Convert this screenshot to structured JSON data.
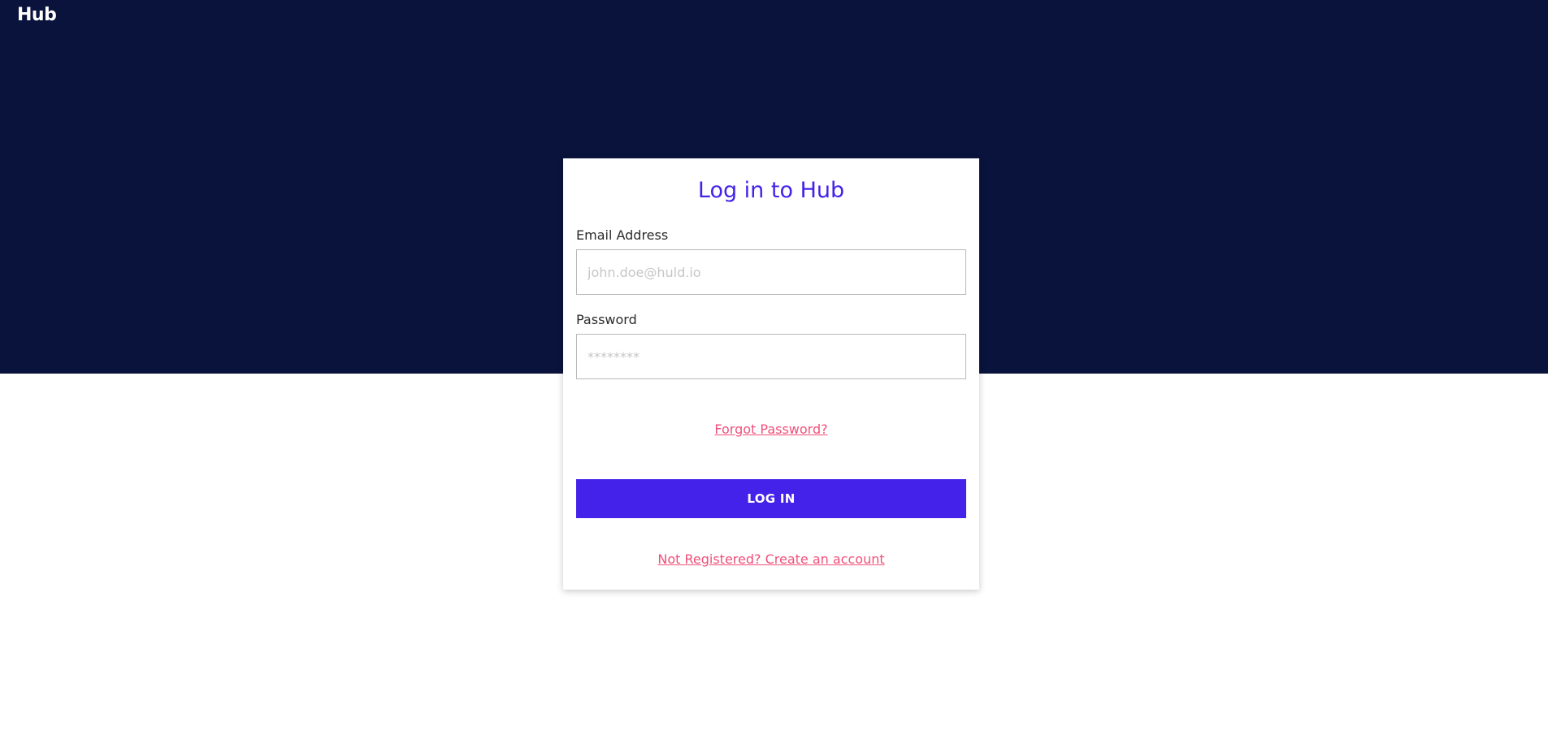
{
  "header": {
    "brand": "Hub"
  },
  "login_card": {
    "title": "Log in to Hub",
    "email": {
      "label": "Email Address",
      "value": "",
      "placeholder": "john.doe@huld.io"
    },
    "password": {
      "label": "Password",
      "value": "",
      "placeholder": "********"
    },
    "forgot_password_link": "Forgot Password?",
    "login_button": "LOG IN",
    "register_link": "Not Registered? Create an account"
  },
  "colors": {
    "hero_background": "#0a133b",
    "accent": "#4422ea",
    "link": "#f0507a"
  }
}
